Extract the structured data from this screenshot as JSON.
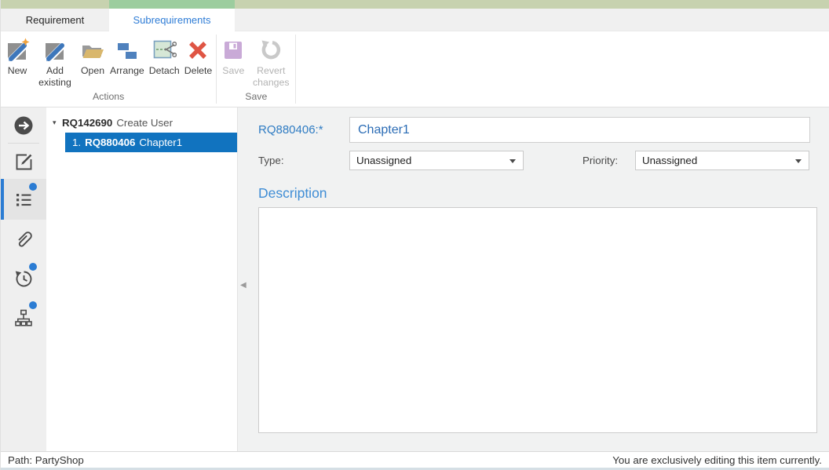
{
  "colors": {
    "accent_green_active": "#9ccd9e",
    "accent_green_muted": "#c7d2af",
    "tab_active_text": "#2e7cd6",
    "selection_blue": "#1173bf",
    "badge_blue": "#2b7cd3",
    "delete_red": "#df5544",
    "field_label_blue": "#2f7cc3"
  },
  "tabs": [
    {
      "label": "Requirement",
      "active": false
    },
    {
      "label": "Subrequirements",
      "active": true
    }
  ],
  "toolbar": {
    "groups": [
      {
        "label": "Actions",
        "buttons": [
          {
            "label": "New",
            "icon": "new-requirement-icon",
            "enabled": true
          },
          {
            "label": "Add existing",
            "icon": "add-existing-icon",
            "enabled": true
          },
          {
            "label": "Open",
            "icon": "open-folder-icon",
            "enabled": true
          },
          {
            "label": "Arrange",
            "icon": "arrange-icon",
            "enabled": true
          },
          {
            "label": "Detach",
            "icon": "detach-icon",
            "enabled": true
          },
          {
            "label": "Delete",
            "icon": "delete-icon",
            "enabled": true
          }
        ]
      },
      {
        "label": "Save",
        "buttons": [
          {
            "label": "Save",
            "icon": "save-icon",
            "enabled": false
          },
          {
            "label": "Revert changes",
            "icon": "revert-changes-icon",
            "enabled": false
          }
        ]
      }
    ]
  },
  "sidebar": {
    "items": [
      {
        "icon": "go-arrow-icon",
        "badge": false,
        "active": false
      },
      {
        "icon": "edit-icon",
        "badge": false,
        "active": false
      },
      {
        "icon": "list-icon",
        "badge": true,
        "active": true
      },
      {
        "icon": "attachment-icon",
        "badge": false,
        "active": false
      },
      {
        "icon": "history-icon",
        "badge": true,
        "active": false
      },
      {
        "icon": "hierarchy-icon",
        "badge": true,
        "active": false
      }
    ]
  },
  "tree": {
    "expander_icon": "▾",
    "parent": {
      "id": "RQ142690",
      "title": "Create User"
    },
    "children": [
      {
        "prefix": "1.",
        "id": "RQ880406",
        "title": "Chapter1",
        "selected": true
      }
    ]
  },
  "form": {
    "id_label": "RQ880406:*",
    "title_value": "Chapter1",
    "type_label": "Type:",
    "type_value": "Unassigned",
    "priority_label": "Priority:",
    "priority_value": "Unassigned",
    "description_label": "Description",
    "description_value": ""
  },
  "statusbar": {
    "path": "Path: PartyShop",
    "editing_notice": "You are exclusively editing this item currently."
  }
}
